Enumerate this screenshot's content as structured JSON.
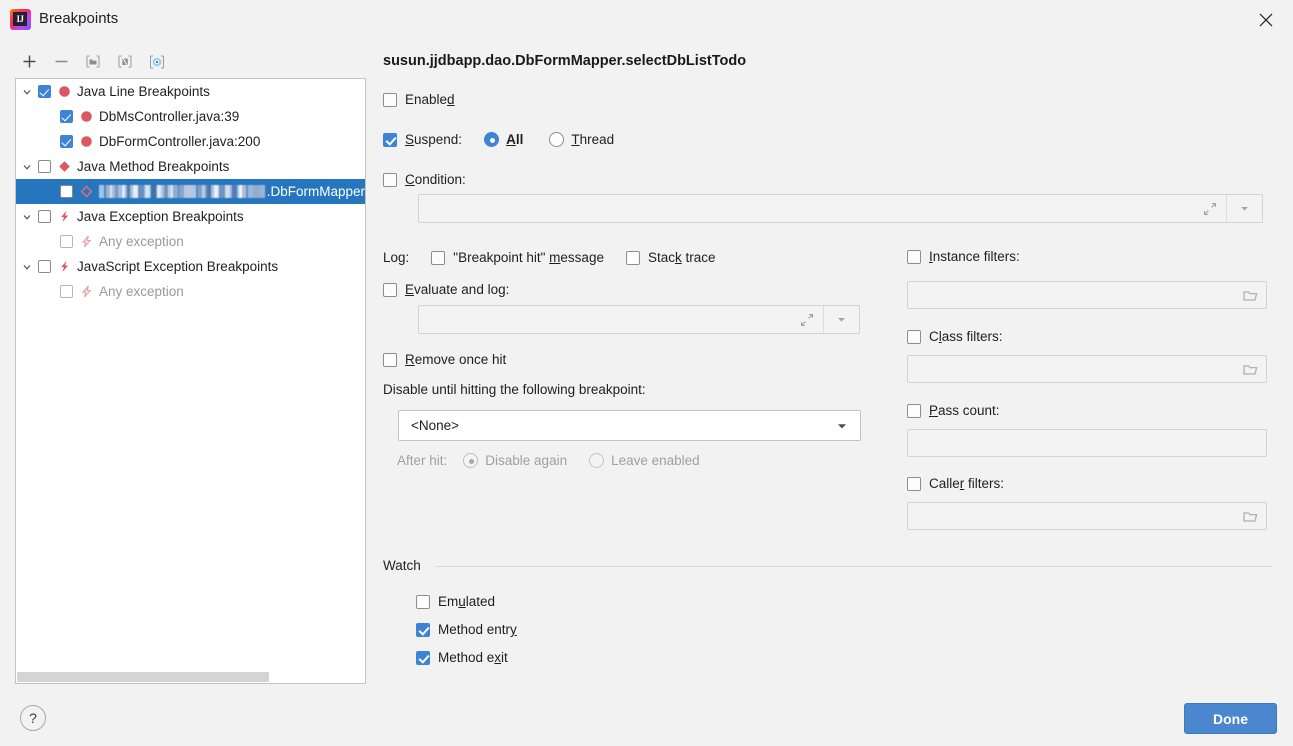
{
  "window": {
    "title": "Breakpoints",
    "logo_icon": "intellij-idea-logo",
    "close_icon": "close-icon"
  },
  "toolbar": {
    "buttons": [
      {
        "name": "add-breakpoint-button",
        "icon": "plus-icon",
        "label": "+"
      },
      {
        "name": "remove-breakpoint-button",
        "icon": "minus-icon",
        "label": "−"
      },
      {
        "name": "group-breakpoints-button",
        "icon": "folder-icon",
        "label": ""
      },
      {
        "name": "mute-breakpoints-button",
        "icon": "mute-icon",
        "label": ""
      },
      {
        "name": "view-breakpoints-source-button",
        "icon": "target-circle-icon",
        "label": ""
      }
    ]
  },
  "tree": {
    "nodes": [
      {
        "label": "Java Line Breakpoints",
        "icon": "red-circle-icon",
        "checked": true,
        "expandable": true,
        "level": 0,
        "selected": false,
        "dim": false
      },
      {
        "label": "DbMsController.java:39",
        "icon": "red-circle-icon",
        "checked": true,
        "expandable": false,
        "level": 1,
        "selected": false,
        "dim": false
      },
      {
        "label": "DbFormController.java:200",
        "icon": "red-circle-icon",
        "checked": true,
        "expandable": false,
        "level": 1,
        "selected": false,
        "dim": false
      },
      {
        "label": "Java Method Breakpoints",
        "icon": "red-diamond-icon",
        "checked": false,
        "expandable": true,
        "level": 0,
        "selected": false,
        "dim": false
      },
      {
        "label": ".DbFormMapper",
        "icon": "method-diamond-icon",
        "checked": false,
        "expandable": false,
        "level": 1,
        "selected": true,
        "dim": false,
        "censored_prefix": true
      },
      {
        "label": "Java Exception Breakpoints",
        "icon": "red-lightning-icon",
        "checked": false,
        "expandable": true,
        "level": 0,
        "selected": false,
        "dim": false
      },
      {
        "label": "Any exception",
        "icon": "lightning-icon-dim",
        "checked": false,
        "expandable": false,
        "level": 1,
        "selected": false,
        "dim": true
      },
      {
        "label": "JavaScript Exception Breakpoints",
        "icon": "red-lightning-icon",
        "checked": false,
        "expandable": true,
        "level": 0,
        "selected": false,
        "dim": false
      },
      {
        "label": "Any exception",
        "icon": "lightning-icon-dim",
        "checked": false,
        "expandable": false,
        "level": 1,
        "selected": false,
        "dim": true
      }
    ]
  },
  "detail": {
    "breakpoint_title": "susun.jjdbapp.dao.DbFormMapper.selectDbListTodo",
    "enabled": {
      "label": "Enabled",
      "checked": false
    },
    "suspend": {
      "label": "Suspend:",
      "checked": true,
      "options": [
        {
          "label": "All",
          "selected": true
        },
        {
          "label": "Thread",
          "selected": false
        }
      ]
    },
    "condition": {
      "label": "Condition:",
      "checked": false,
      "value": "",
      "expand_icon": "expand-icon",
      "dropdown_icon": "chevron-down-icon"
    },
    "log": {
      "label": "Log:",
      "breakpoint_hit_message": {
        "label": "\"Breakpoint hit\" message",
        "checked": false
      },
      "stack_trace": {
        "label": "Stack trace",
        "checked": false
      }
    },
    "evaluate_and_log": {
      "label": "Evaluate and log:",
      "checked": false,
      "value": "",
      "expand_icon": "expand-icon",
      "dropdown_icon": "chevron-down-icon"
    },
    "remove_once_hit": {
      "label": "Remove once hit",
      "checked": false
    },
    "disable_until": {
      "label": "Disable until hitting the following breakpoint:",
      "selected_value": "<None>",
      "options": [
        "<None>"
      ]
    },
    "after_hit": {
      "label": "After hit:",
      "disabled": true,
      "options": [
        {
          "label": "Disable again",
          "selected": true
        },
        {
          "label": "Leave enabled",
          "selected": false
        }
      ]
    },
    "filters": {
      "instance": {
        "label": "Instance filters:",
        "checked": false,
        "value": "",
        "browse_icon": "folder-icon"
      },
      "class": {
        "label": "Class filters:",
        "checked": false,
        "value": "",
        "browse_icon": "folder-icon"
      },
      "pass_count": {
        "label": "Pass count:",
        "checked": false,
        "value": ""
      },
      "caller": {
        "label": "Caller filters:",
        "checked": false,
        "value": "",
        "browse_icon": "folder-icon"
      }
    },
    "watch": {
      "title": "Watch",
      "items": [
        {
          "label": "Emulated",
          "checked": false
        },
        {
          "label": "Method entry",
          "checked": true
        },
        {
          "label": "Method exit",
          "checked": true
        }
      ]
    }
  },
  "footer": {
    "help_label": "?",
    "help_icon": "question-mark-icon",
    "done_label": "Done"
  },
  "colors": {
    "accent": "#3d84d6",
    "selection": "#2675bf",
    "button": "#4a87cf",
    "breakpoint_red": "#db5860",
    "background": "#f2f2f2",
    "panel": "#ffffff"
  }
}
